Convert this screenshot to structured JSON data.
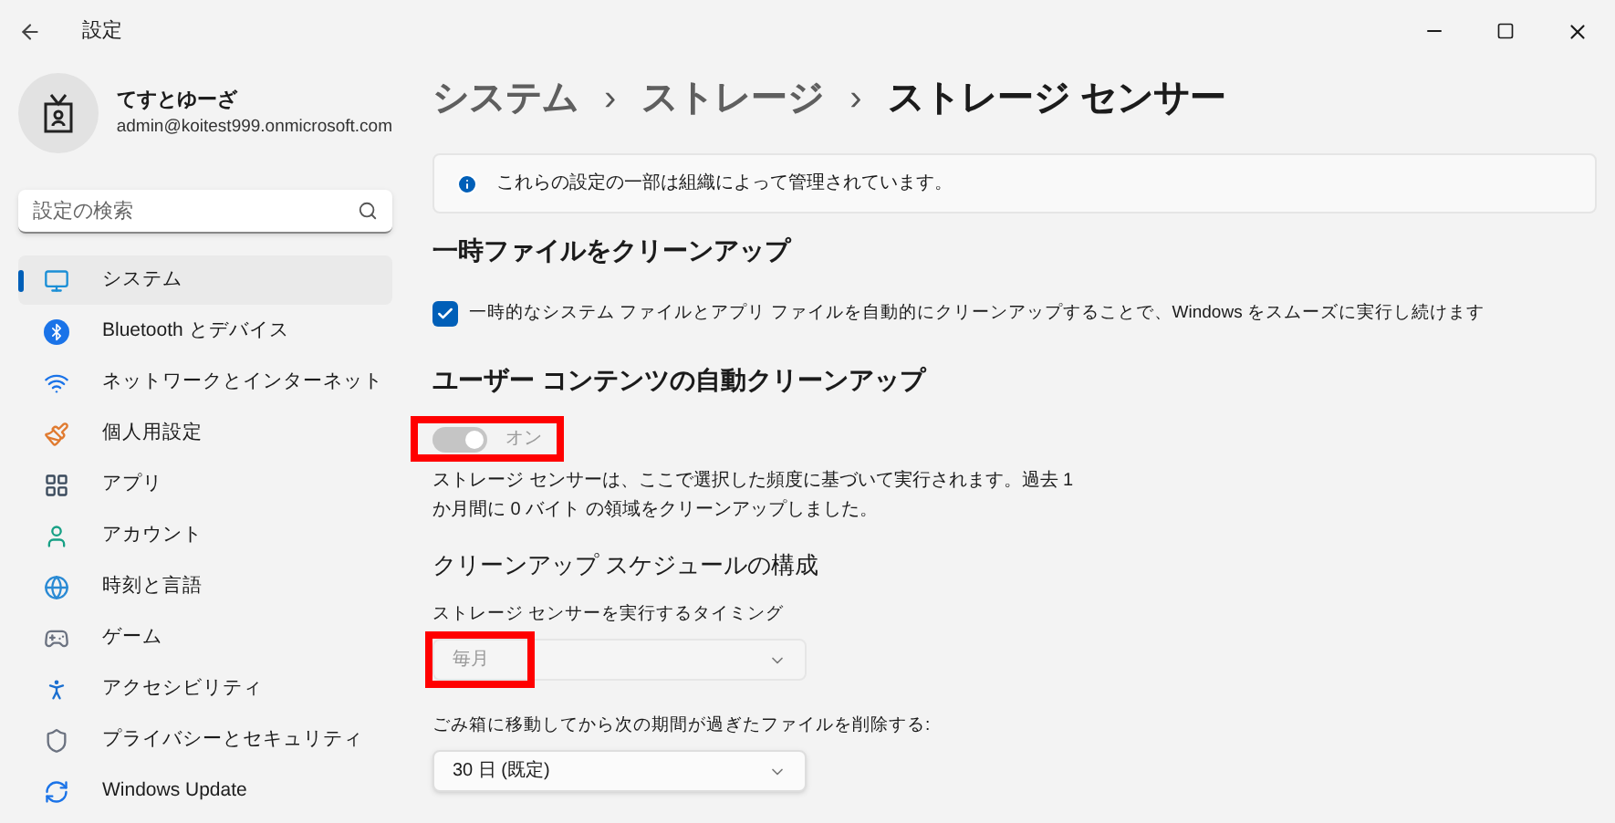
{
  "window": {
    "title": "設定"
  },
  "user": {
    "name": "てすとゆーざ",
    "email": "admin@koitest999.onmicrosoft.com"
  },
  "search": {
    "placeholder": "設定の検索"
  },
  "sidebar": {
    "items": [
      {
        "label": "システム",
        "selected": true
      },
      {
        "label": "Bluetooth とデバイス",
        "selected": false
      },
      {
        "label": "ネットワークとインターネット",
        "selected": false
      },
      {
        "label": "個人用設定",
        "selected": false
      },
      {
        "label": "アプリ",
        "selected": false
      },
      {
        "label": "アカウント",
        "selected": false
      },
      {
        "label": "時刻と言語",
        "selected": false
      },
      {
        "label": "ゲーム",
        "selected": false
      },
      {
        "label": "アクセシビリティ",
        "selected": false
      },
      {
        "label": "プライバシーとセキュリティ",
        "selected": false
      },
      {
        "label": "Windows Update",
        "selected": false
      }
    ]
  },
  "breadcrumb": [
    "システム",
    "ストレージ",
    "ストレージ センサー"
  ],
  "breadcrumb_separator": "›",
  "info": "これらの設定の一部は組織によって管理されています。",
  "temp_section": {
    "title": "一時ファイルをクリーンアップ",
    "checkbox": {
      "label": "一時的なシステム ファイルとアプリ ファイルを自動的にクリーンアップすることで、Windows をスムーズに実行し続けます",
      "checked": true
    }
  },
  "auto_section": {
    "title": "ユーザー コンテンツの自動クリーンアップ",
    "toggle": {
      "on": true,
      "disabled": true,
      "label": "オン",
      "highlighted": true
    },
    "description": "ストレージ センサーは、ここで選択した頻度に基づいて実行されます。過去 1 か月間に 0 バイト の領域をクリーンアップしました。"
  },
  "schedule_section": {
    "title": "クリーンアップ スケジュールの構成",
    "fields": [
      {
        "label": "ストレージ センサーを実行するタイミング",
        "value": "毎月",
        "disabled": true,
        "highlighted": true
      },
      {
        "label": "ごみ箱に移動してから次の期間が過ぎたファイルを削除する:",
        "value": "30 日 (既定)",
        "disabled": false,
        "highlighted": false
      }
    ]
  }
}
